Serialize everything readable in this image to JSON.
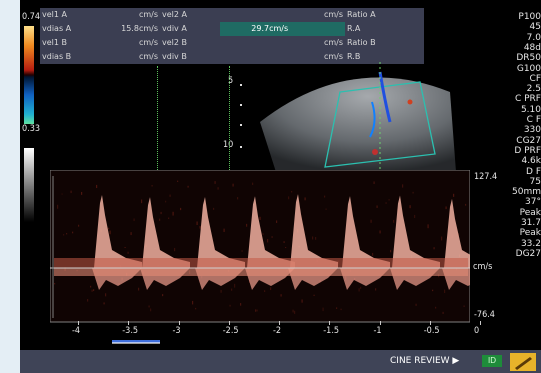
{
  "measurements": {
    "rows": [
      {
        "c1": "vel1 A",
        "c2": "cm/s",
        "c3": "vel2 A",
        "c4": "",
        "c5": "cm/s",
        "c6": "Ratio A",
        "selected": false
      },
      {
        "c1": "vdias A",
        "c2": "15.8cm/s",
        "c3": "vdiv A",
        "c4": "29.7cm/s",
        "c5": "",
        "c6": "R.A",
        "selected": true
      },
      {
        "c1": "vel1 B",
        "c2": "cm/s",
        "c3": "vel2 B",
        "c4": "",
        "c5": "cm/s",
        "c6": "Ratio B",
        "selected": false
      },
      {
        "c1": "vdias B",
        "c2": "cm/s",
        "c3": "vdiv B",
        "c4": "",
        "c5": "cm/s",
        "c6": "R.B",
        "selected": false
      }
    ]
  },
  "color_scale": {
    "top": "0.74",
    "bottom": "0.33"
  },
  "depth_markers": [
    "5",
    "10"
  ],
  "spectrum": {
    "scale_top": "127.4",
    "scale_bottom": "-76.4",
    "unit": "cm/s",
    "time_ticks": [
      "-4",
      "-3.5",
      "-3",
      "-2.5",
      "-2",
      "-1.5",
      "-1",
      "-0.5",
      "0"
    ]
  },
  "right_panel": [
    "P100",
    "45",
    "7.0",
    "48d",
    "DR50",
    "G100",
    "CF",
    "2.5",
    "C PRF",
    "5.10",
    "C F",
    "330",
    "CG27",
    "D PRF",
    "4.6k",
    "D F",
    "75",
    "50mm",
    "37°",
    "Peak",
    "31.7",
    "Peak",
    "33.2",
    "DG27"
  ],
  "footer": {
    "cine_label": "CINE REVIEW ▶",
    "badge_text": "ID"
  },
  "colors": {
    "background": "#e4eef5",
    "screen": "#000000",
    "panel": "#3b3e52",
    "selected": "#1f6b63",
    "doppler": "#f2b0a0",
    "footer": "#3f4457"
  }
}
